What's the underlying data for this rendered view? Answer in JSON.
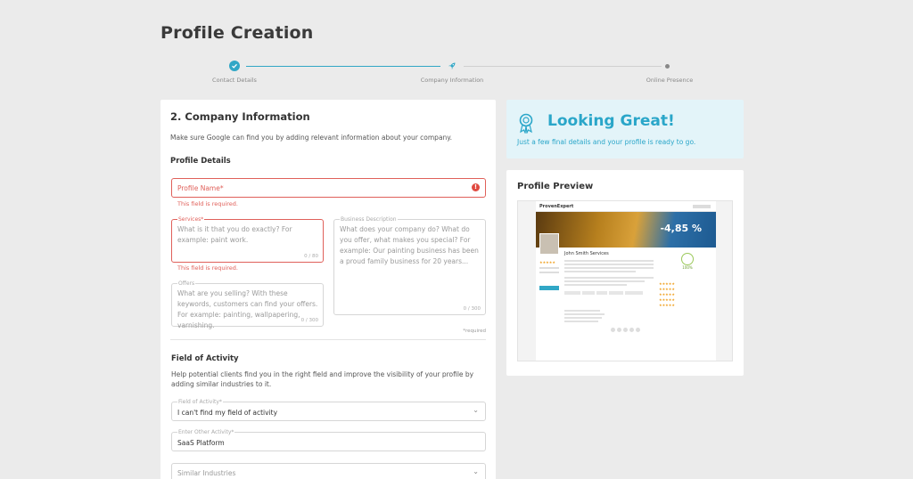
{
  "page": {
    "title": "Profile Creation"
  },
  "stepper": {
    "steps": [
      {
        "label": "Contact Details",
        "state": "done"
      },
      {
        "label": "Company Information",
        "state": "current"
      },
      {
        "label": "Online Presence",
        "state": "todo"
      }
    ]
  },
  "form": {
    "heading": "2. Company Information",
    "intro": "Make sure Google can find you by adding relevant information about your company.",
    "profile_details_heading": "Profile Details",
    "profile_name": {
      "label": "Profile Name*",
      "error": "This field is required."
    },
    "services": {
      "label": "Services*",
      "placeholder": "What is it that you do exactly? For example: paint work.",
      "counter": "0 / 80",
      "error": "This field is required."
    },
    "business_description": {
      "label": "Business Description",
      "placeholder": "What does your company do? What do you offer, what makes you special? For example: Our painting business has been a proud family business for 20 years...",
      "counter": "0 / 300"
    },
    "offers": {
      "label": "Offers",
      "placeholder": "What are you selling? With these keywords, customers can find your offers. For example: painting, wallpapering, varnishing.",
      "counter": "0 / 300"
    },
    "required_note": "*required",
    "field_of_activity_heading": "Field of Activity",
    "field_of_activity_intro": "Help potential clients find you in the right field and improve the visibility of your profile by adding similar industries to it.",
    "field_of_activity": {
      "label": "Field of Activity*",
      "value": "I can't find my field of activity"
    },
    "other_activity": {
      "label": "Enter Other Activity*",
      "value": "SaaS Platform"
    },
    "similar_industries": {
      "placeholder": "Similar Industries"
    }
  },
  "great": {
    "title": "Looking Great!",
    "subtitle": "Just a few final details and your profile is ready to go."
  },
  "preview": {
    "title": "Profile Preview",
    "mock": {
      "brand": "ProvenExpert",
      "banner_value": "-4,85 %",
      "company_name": "John Smith Services",
      "rating": "100%"
    }
  },
  "colors": {
    "accent": "#31a7c6",
    "error": "#e0605a",
    "great_bg": "#e3f4f9"
  }
}
